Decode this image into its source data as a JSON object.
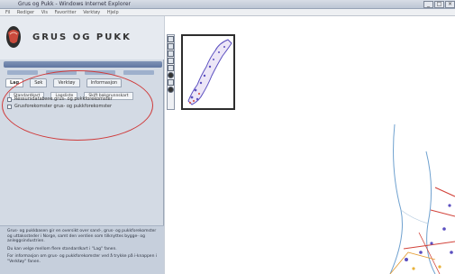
{
  "window": {
    "title": "Grus og Pukk - Windows Internet Explorer",
    "controls": [
      "_",
      "□",
      "×"
    ],
    "menu": [
      "Fil",
      "Rediger",
      "Vis",
      "Favoritter",
      "Verktøy",
      "Hjelp"
    ]
  },
  "app": {
    "title": "GRUS OG PUKK"
  },
  "tabs": [
    "Lag",
    "Søk",
    "Verktøy",
    "Informasjon"
  ],
  "subtabs": [
    "Standardkart",
    "Lagsliste",
    "Skift bakgrunnskart"
  ],
  "layers": [
    {
      "label": "Ressursdatabase grus- og pukkforekomster",
      "checked": false
    },
    {
      "label": "Grusforekomster grus- og pukkforekomster",
      "checked": false
    }
  ],
  "info": {
    "paragraphs": [
      "Grus- og pukkbasen gir en oversikt over sand-, grus- og pukkforekomster og uttakssteder i Norge, samt den verdien som tilknyttes bygge- og anleggsindustrien.",
      "Du kan velge mellom flere standardkart i \"Lag\" fanen.",
      "For informasjon om grus- og pukkforekomster ved å trykke på i-knappen i \"Verktøy\" fanen."
    ]
  },
  "colors": {
    "highlight_ring": "#cf3a3a",
    "map_deposits": "#5b4fc0",
    "map_roads": "#d2433a",
    "coast": "#6fa1cf"
  },
  "icons": [
    "zoom-in-icon",
    "zoom-out-icon",
    "pan-icon",
    "info-icon",
    "measure-icon",
    "print-icon",
    "globe-icon",
    "home-icon"
  ]
}
